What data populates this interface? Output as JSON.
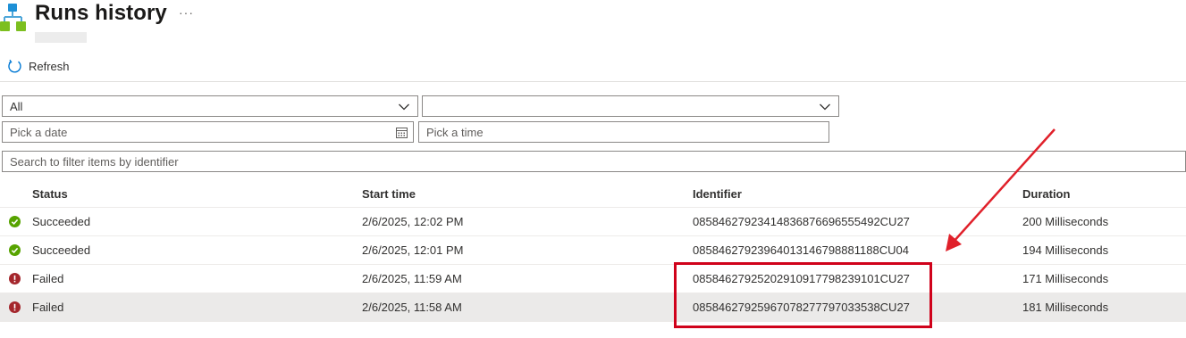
{
  "header": {
    "title": "Runs history",
    "more_label": "···"
  },
  "toolbar": {
    "refresh_label": "Refresh"
  },
  "filters": {
    "status_value": "All",
    "second_value": "",
    "date_placeholder": "Pick a date",
    "time_placeholder": "Pick a time",
    "search_placeholder": "Search to filter items by identifier"
  },
  "table": {
    "columns": [
      "Status",
      "Start time",
      "Identifier",
      "Duration"
    ],
    "rows": [
      {
        "status": "Succeeded",
        "start_time": "2/6/2025, 12:02 PM",
        "identifier": "08584627923414836876696555492CU27",
        "duration": "200 Milliseconds"
      },
      {
        "status": "Succeeded",
        "start_time": "2/6/2025, 12:01 PM",
        "identifier": "08584627923964013146798881188CU04",
        "duration": "194 Milliseconds"
      },
      {
        "status": "Failed",
        "start_time": "2/6/2025, 11:59 AM",
        "identifier": "08584627925202910917798239101CU27",
        "duration": "171 Milliseconds"
      },
      {
        "status": "Failed",
        "start_time": "2/6/2025, 11:58 AM",
        "identifier": "08584627925967078277797033538CU27",
        "duration": "181 Milliseconds"
      }
    ]
  },
  "colors": {
    "success": "#57a300",
    "failure": "#a4262c",
    "annotation": "#d0021b"
  },
  "icons": [
    "logic-app-icon",
    "refresh-icon",
    "chevron-down-icon",
    "calendar-icon",
    "success-check-icon",
    "error-icon"
  ]
}
